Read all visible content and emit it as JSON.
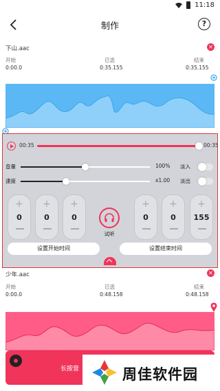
{
  "status_bar": {
    "time": "11:18"
  },
  "header": {
    "title": "制作",
    "help_icon": "question-circle-icon"
  },
  "labels": {
    "start": "开始",
    "selected": "已选",
    "end": "结束"
  },
  "track1": {
    "filename": "下山.aac",
    "start": "0:00.0",
    "selected": "0:35.155",
    "end": "0:35.155",
    "color": "#5bb8f5"
  },
  "editor": {
    "current_time": "00:35",
    "total_time": "00:35",
    "progress": 1.0,
    "volume_label": "音量",
    "volume_value": "100%",
    "volume_level": 0.5,
    "speed_label": "速度",
    "speed_value": "x1.00",
    "speed_level": 0.35,
    "fade_in_label": "淡入",
    "fade_out_label": "淡出",
    "fade_in_on": false,
    "fade_out_on": false,
    "start_steppers": [
      "0",
      "0",
      "0"
    ],
    "end_steppers": [
      "0",
      "0",
      "155"
    ],
    "preview_label": "试听",
    "set_start_label": "设置开始时间",
    "set_end_label": "设置结束时间",
    "accent": "#f0345a"
  },
  "track2": {
    "filename": "少年.aac",
    "start": "0:00.0",
    "selected": "0:48.158",
    "end": "0:48.158",
    "color": "#ff5c87"
  },
  "record_button": {
    "label": "长按音"
  },
  "watermark": {
    "text": "周佳软件园"
  }
}
